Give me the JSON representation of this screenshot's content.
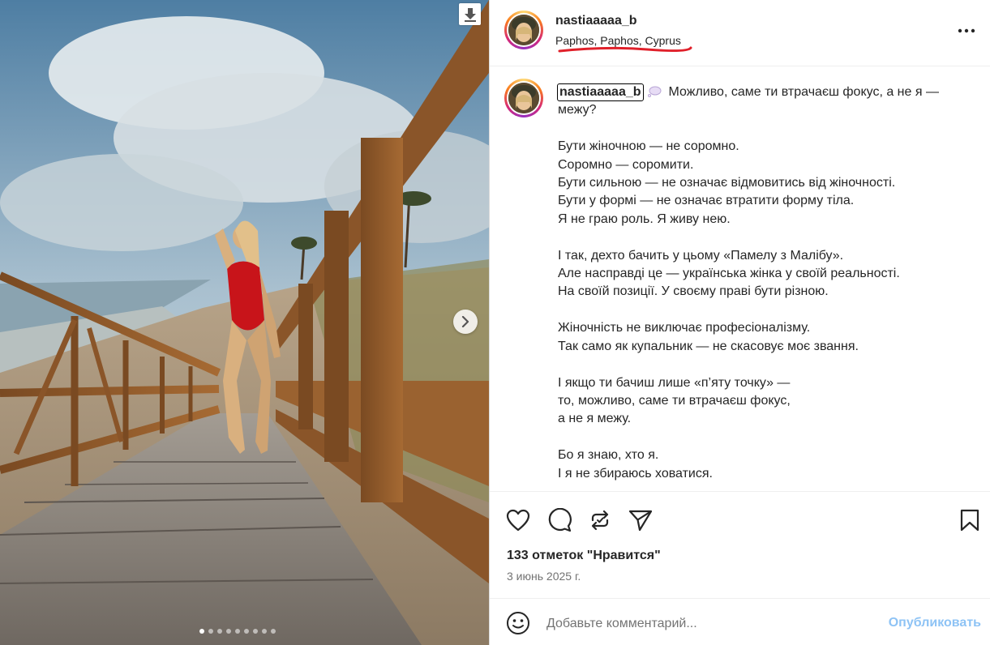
{
  "post": {
    "username": "nastiaaaaa_b",
    "location": "Paphos, Paphos, Cyprus",
    "caption_username": "nastiaaaaa_b",
    "caption_text": "Можливо, саме ти втрачаєш фокус, а не я — межу?\n\nБути жіночною — не соромно.\nСоромно — соромити.\nБути сильною — не означає відмовитись від жіночності.\nБути у формі — не означає втратити форму тіла.\nЯ не граю роль. Я живу нею.\n\nІ так, дехто бачить у цьому «Памелу з Малібу».\nАле насправді це — українська жінка у своїй реальності.\nНа своїй позиції. У своєму праві бути різною.\n\nЖіночність не виключає професіоналізму.\nТак само як купальник — не скасовує моє звання.\n\nІ якщо ти бачиш лише «п’яту точку» —\nто, можливо, саме ти втрачаєш фокус,\nа не я межу.\n\nБо я знаю, хто я.\nІ я не збираюсь ховатися.",
    "likes": "133 отметок \"Нравится\"",
    "date": "3 июнь 2025 г.",
    "carousel": {
      "total": 9,
      "current": 1
    }
  },
  "comment": {
    "placeholder": "Добавьте комментарий...",
    "publish_label": "Опубликовать"
  },
  "icons": {
    "download": "download-icon",
    "next": "chevron-right-icon",
    "more": "more-options-icon",
    "like": "heart-icon",
    "comment": "comment-icon",
    "repost": "repost-icon",
    "share": "send-icon",
    "save": "bookmark-icon",
    "emoji": "emoji-icon",
    "bubble": "thought-bubble-emoji"
  },
  "colors": {
    "accent_underline": "#e0202a",
    "publish": "#8ec3f5",
    "text": "#262626",
    "muted": "#737373"
  }
}
